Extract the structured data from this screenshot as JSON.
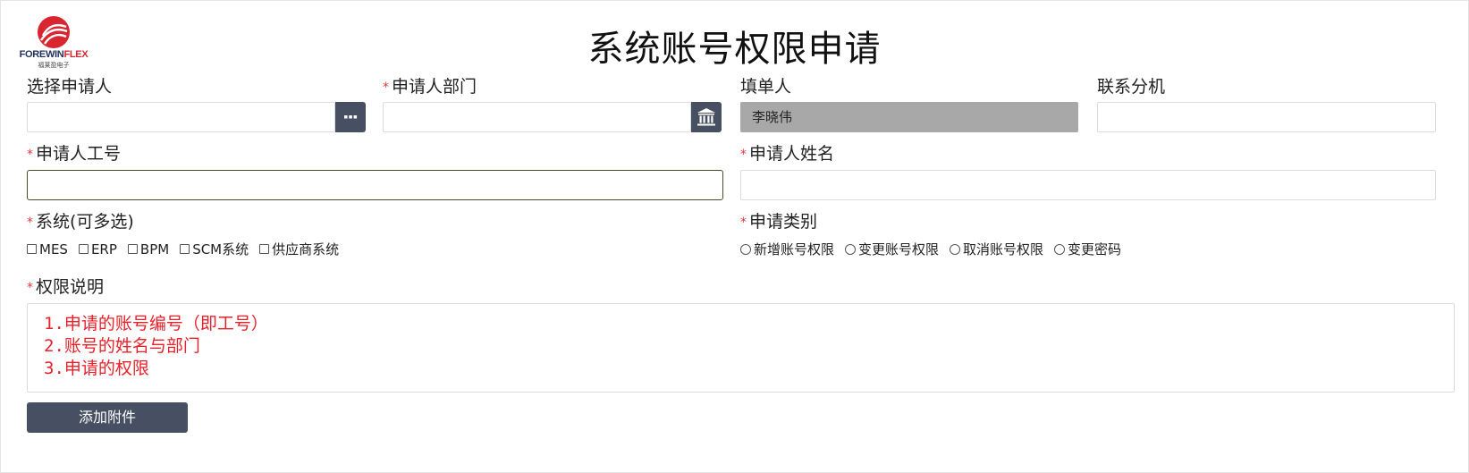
{
  "logo": {
    "brand_main": "FOREWIN",
    "brand_accent": "FLEX",
    "brand_sub": "福莱盈电子"
  },
  "page_title": "系统账号权限申请",
  "fields": {
    "applicant_select": {
      "label": "选择申请人",
      "value": ""
    },
    "department": {
      "label": "申请人部门",
      "value": ""
    },
    "filler": {
      "label": "填单人",
      "value": "李晓伟"
    },
    "extension": {
      "label": "联系分机",
      "value": ""
    },
    "employee_id": {
      "label": "申请人工号",
      "value": ""
    },
    "applicant_name": {
      "label": "申请人姓名",
      "value": ""
    }
  },
  "systems": {
    "label": "系统(可多选)",
    "options": [
      "MES",
      "ERP",
      "BPM",
      "SCM系统",
      "供应商系统"
    ]
  },
  "request_type": {
    "label": "申请类别",
    "options": [
      "新增账号权限",
      "变更账号权限",
      "取消账号权限",
      "变更密码"
    ]
  },
  "permission_desc": {
    "label": "权限说明",
    "lines": [
      "1.申请的账号编号（即工号）",
      "2.账号的姓名与部门",
      "3.申请的权限"
    ]
  },
  "attach_button": "添加附件",
  "required_mark": "*",
  "colors": {
    "required": "#e53935",
    "hint_text": "#e8212a",
    "button_bg": "#475063",
    "disabled_bg": "#a8a8a8",
    "logo_red": "#d9252f",
    "logo_navy": "#1f2f5c"
  }
}
